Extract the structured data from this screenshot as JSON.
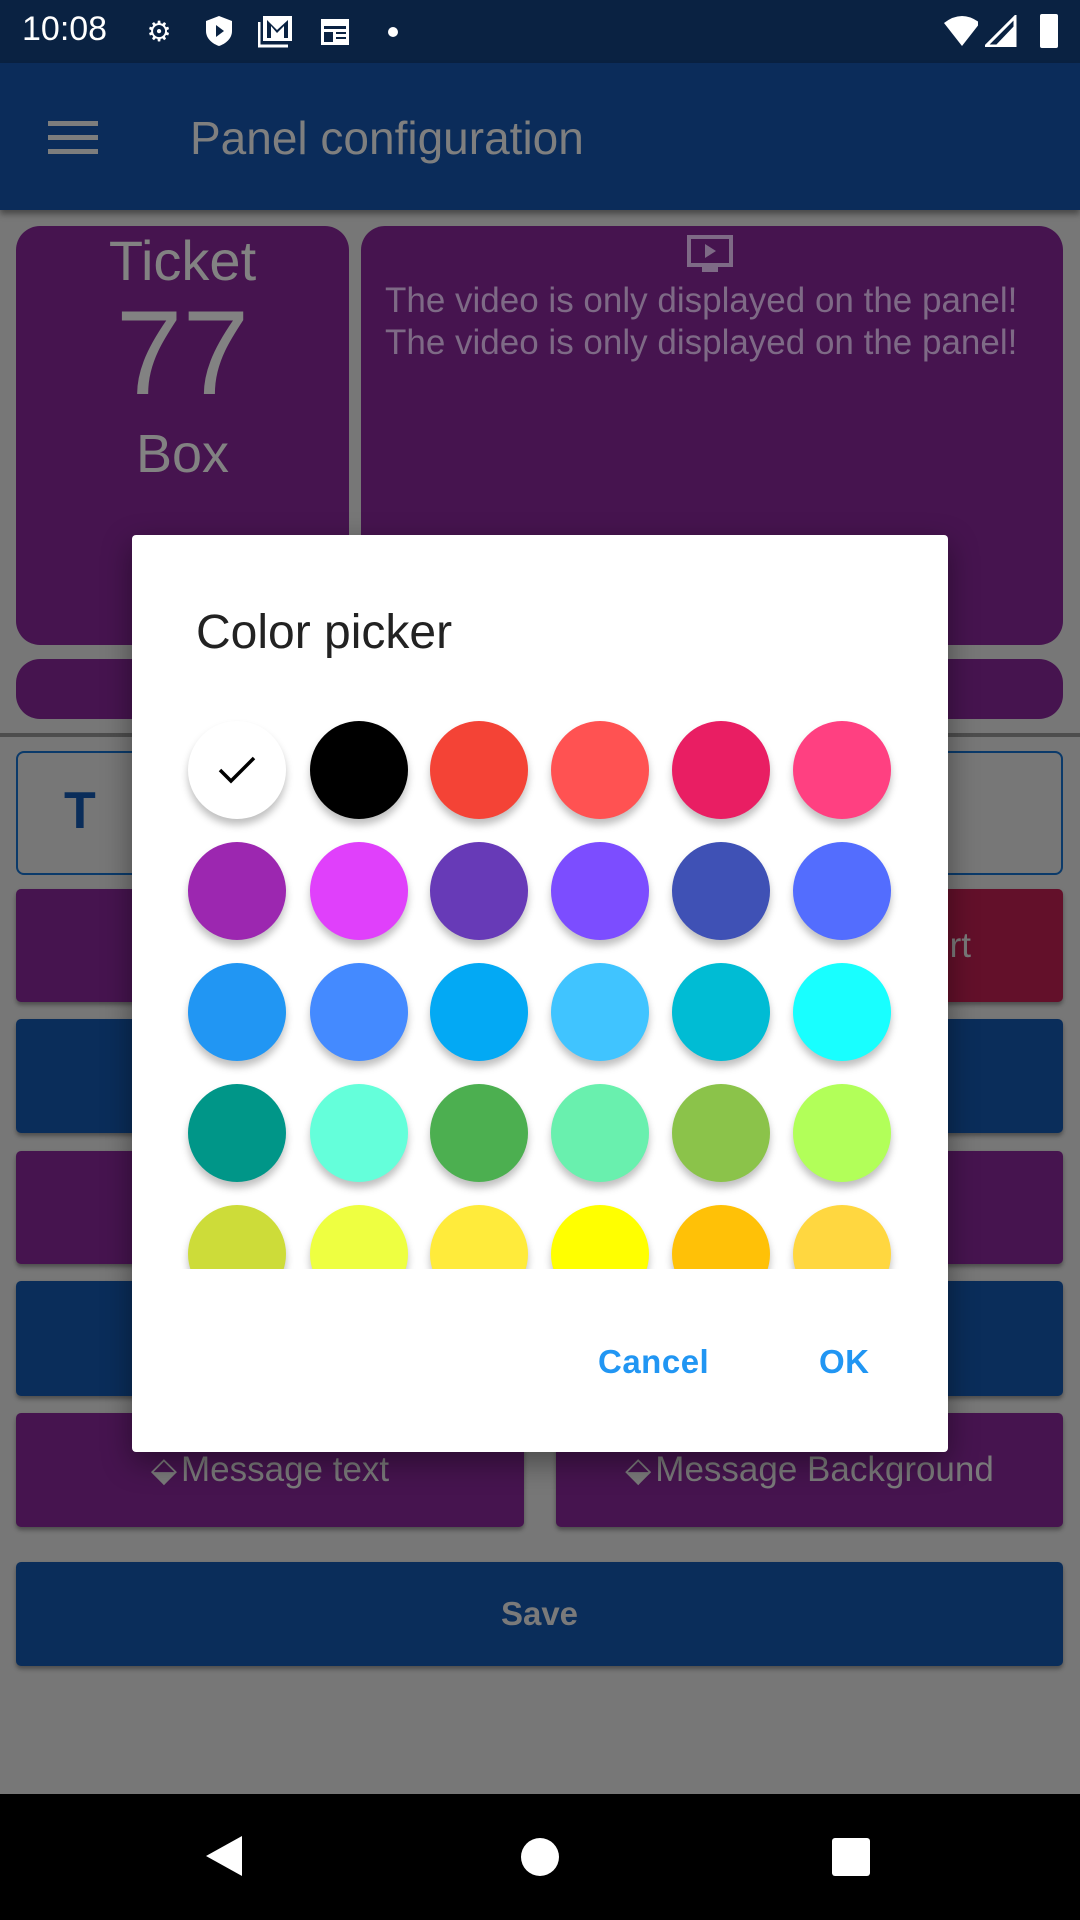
{
  "status_bar": {
    "time": "10:08",
    "icons": [
      "gear-icon",
      "shield-play-icon",
      "gmail-icon",
      "calendar-icon",
      "dot-icon",
      "wifi-icon",
      "signal-icon",
      "battery-icon"
    ]
  },
  "app_bar": {
    "title": "Panel configuration",
    "menu_icon": "hamburger-icon"
  },
  "preview": {
    "ticket_label": "Ticket",
    "ticket_number": "77",
    "box_label": "Box",
    "video_icon": "tv-play-icon",
    "video_line1": "The video is only displayed on the panel!",
    "video_line2": "The video is only displayed on the panel!"
  },
  "form": {
    "outlined_letter": "T",
    "row1_right_fragment": "rt",
    "message_text": "Message text",
    "message_background": "Message Background",
    "save": "Save"
  },
  "dialog": {
    "title": "Color picker",
    "cancel": "Cancel",
    "ok": "OK",
    "selected": "#FFFFFF",
    "colors": [
      "#FFFFFF",
      "#000000",
      "#F44336",
      "#FF5252",
      "#E91E63",
      "#FF4081",
      "#9C27B0",
      "#E040FB",
      "#673AB7",
      "#7C4DFF",
      "#3F51B5",
      "#536DFE",
      "#2196F3",
      "#448AFF",
      "#03A9F4",
      "#40C4FF",
      "#00BCD4",
      "#18FFFF",
      "#009688",
      "#64FFDA",
      "#4CAF50",
      "#69F0AE",
      "#8BC34A",
      "#B2FF59",
      "#CDDC39",
      "#EEFF41",
      "#FFEB3B",
      "#FFFF00",
      "#FFC107",
      "#FFD740"
    ]
  },
  "colors": {
    "purple": "#46144f",
    "blue": "#0a2d5a",
    "red": "#63102a",
    "accent": "#2196f3"
  }
}
